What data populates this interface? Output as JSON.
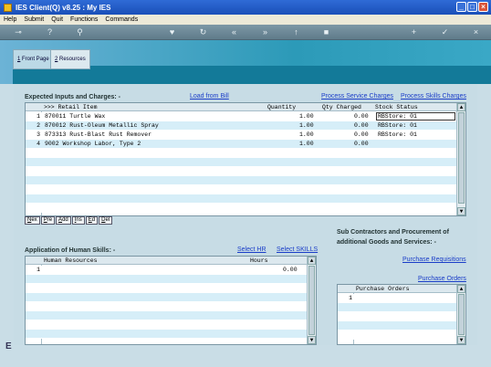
{
  "window": {
    "title": "IES Client(Q) v8.25 : My IES",
    "controls": [
      "_",
      "□",
      "×"
    ]
  },
  "menu": [
    "Help",
    "Submit",
    "Quit",
    "Functions",
    "Commands"
  ],
  "toolbar_icons": [
    "key-icon",
    "help-icon",
    "search-icon",
    "heart-icon",
    "refresh-icon",
    "rewind-icon",
    "forward-icon",
    "upload-icon",
    "stop-icon",
    "add-icon",
    "check-icon",
    "close-icon"
  ],
  "tabs": [
    {
      "key": "1",
      "label": "Front Page",
      "active": false
    },
    {
      "key": "2",
      "label": "Resources",
      "active": true
    }
  ],
  "expected": {
    "title": "Expected Inputs and Charges: -",
    "load_link": "Load from Bill",
    "service_link": "Process Service Charges",
    "skills_link": "Process Skills Charges",
    "headers": {
      "item": ">>> Retail Item",
      "qty": "Quantity",
      "qty_charged": "Qty Charged",
      "stock": "Stock Status"
    },
    "rows": [
      {
        "num": "1",
        "item": "870011 Turtle Wax",
        "qty": "1.00",
        "qty_charged": "0.00",
        "stock": "RBStore: 01"
      },
      {
        "num": "2",
        "item": "870012 Rust-Oleum Metallic Spray",
        "qty": "1.00",
        "qty_charged": "0.00",
        "stock": "RBStore: 01"
      },
      {
        "num": "3",
        "item": "873313 Rust-Blast Rust Remover",
        "qty": "1.00",
        "qty_charged": "0.00",
        "stock": "RBStore: 01"
      },
      {
        "num": "4",
        "item": "9002 Workshop Labor, Type 2",
        "qty": "1.00",
        "qty_charged": "0.00",
        "stock": ""
      }
    ],
    "nav_buttons": [
      {
        "u": "N",
        "rest": "ex"
      },
      {
        "u": "P",
        "rest": "re"
      },
      {
        "u": "A",
        "rest": "dd"
      },
      {
        "u": "I",
        "rest": "ns"
      },
      {
        "u": "E",
        "rest": "d"
      },
      {
        "u": "D",
        "rest": "el"
      }
    ]
  },
  "skills": {
    "title": "Application of Human Skills: -",
    "select_hr": "Select HR",
    "select_skills": "Select SKILLS",
    "headers": {
      "hr": "Human Resources",
      "hours": "Hours"
    },
    "rows": [
      {
        "num": "1",
        "hr": "",
        "hours": "0.00"
      }
    ]
  },
  "subcontract": {
    "title_line1": "Sub Contractors and Procurement of",
    "title_line2": "additional Goods and Services: -",
    "purchase_requisitions": "Purchase Requisitions",
    "purchase_orders": "Purchase Orders",
    "header": "Purchase Orders",
    "rows": [
      {
        "num": "1",
        "value": ""
      }
    ]
  },
  "side_letter": "E",
  "colors": {
    "titlebar": "#1a4fb8",
    "link": "#1a3dc8",
    "row_alt": "#d6eef8",
    "tab_band": "#2c9ab8"
  }
}
